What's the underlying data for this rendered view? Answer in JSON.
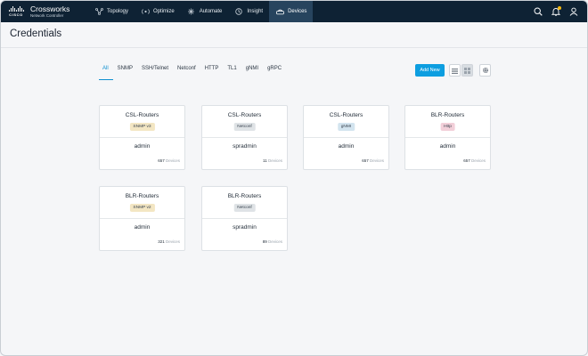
{
  "brand": {
    "logo_text": "CISCO",
    "title": "Crossworks",
    "subtitle": "Network Controller"
  },
  "nav": {
    "items": [
      {
        "label": "Topology",
        "icon": "topology-icon"
      },
      {
        "label": "Optimize",
        "icon": "optimize-icon"
      },
      {
        "label": "Automate",
        "icon": "automate-icon"
      },
      {
        "label": "Insight",
        "icon": "insight-icon"
      },
      {
        "label": "Devices",
        "icon": "devices-icon",
        "active": true
      }
    ],
    "right_icons": [
      "search-icon",
      "bell-icon",
      "user-icon"
    ],
    "notification_dot_color": "#f5b90f"
  },
  "page": {
    "title": "Credentials"
  },
  "tabs": [
    {
      "label": "All",
      "active": true
    },
    {
      "label": "SNMP"
    },
    {
      "label": "SSH/Telnet"
    },
    {
      "label": "Netconf"
    },
    {
      "label": "HTTP"
    },
    {
      "label": "TL1"
    },
    {
      "label": "gNMI"
    },
    {
      "label": "gRPC"
    }
  ],
  "toolbar": {
    "add_label": "Add New",
    "view_icons": [
      "list-view-icon",
      "grid-view-icon",
      "settings-icon"
    ],
    "accent_color": "#0d9ee0"
  },
  "cards": [
    {
      "name": "CSL-Routers",
      "protocol": "SNMP v3",
      "user": "admin",
      "count": "657",
      "unit": "Devices"
    },
    {
      "name": "CSL-Routers",
      "protocol": "Netconf",
      "user": "spradmin",
      "count": "11",
      "unit": "Devices"
    },
    {
      "name": "CSL-Routers",
      "protocol": "gNMI",
      "user": "admin",
      "count": "657",
      "unit": "Devices"
    },
    {
      "name": "BLR-Routers",
      "protocol": "Http",
      "user": "admin",
      "count": "657",
      "unit": "Devices"
    },
    {
      "name": "BLR-Routers",
      "protocol": "SNMP v2",
      "user": "admin",
      "count": "321",
      "unit": "Devices"
    },
    {
      "name": "BLR-Routers",
      "protocol": "Netconf",
      "user": "spradmin",
      "count": "89",
      "unit": "Devices"
    }
  ],
  "badge_colors": {
    "SNMP v3": "#f3e6c3",
    "SNMP v2": "#f3e6c3",
    "Netconf": "#dfe3e6",
    "gNMI": "#d3e4ef",
    "Http": "#f2cfd9"
  }
}
